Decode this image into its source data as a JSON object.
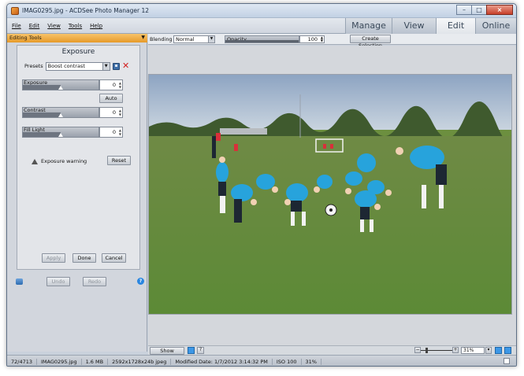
{
  "window": {
    "title": "IMAG0295.jpg - ACDSee Photo Manager 12",
    "minimize": "–",
    "maximize": "□",
    "close": "×"
  },
  "menu": {
    "items": [
      "File",
      "Edit",
      "View",
      "Tools",
      "Help"
    ]
  },
  "modes": {
    "tabs": [
      "Manage",
      "View",
      "Edit",
      "Online"
    ],
    "active": "Edit"
  },
  "editing_panel": {
    "header": "Editing Tools",
    "section_title": "Exposure",
    "presets_label": "Presets",
    "presets_value": "Boost contrast",
    "exposure_label": "Exposure",
    "exposure_value": "0",
    "auto_label": "Auto",
    "contrast_label": "Contrast",
    "contrast_value": "0",
    "fill_light_label": "Fill Light",
    "fill_light_value": "0",
    "exposure_warning_label": "Exposure warning",
    "reset_label": "Reset",
    "apply_label": "Apply",
    "done_label": "Done",
    "cancel_label": "Cancel",
    "undo_label": "Undo",
    "redo_label": "Redo",
    "help_glyph": "?"
  },
  "toolbar": {
    "blending_label": "Blending",
    "blending_value": "Normal",
    "opacity_label": "Opacity",
    "opacity_value": "100",
    "create_selection_label": "Create Selection",
    "opacity_fraction": 1.0
  },
  "bottom": {
    "show_previous_label": "Show Previous",
    "zoom_value": "31%",
    "zoom_minus": "−",
    "zoom_plus": "+"
  },
  "status": {
    "position": "72/4713",
    "filename": "IMAG0295.jpg",
    "filesize": "1.6 MB",
    "dimensions": "2592x1728x24b jpeg",
    "modified": "Modified Date: 1/7/2012 3:14:32 PM",
    "iso": "ISO 100",
    "zoom": "31%"
  },
  "colors": {
    "panel_header": "#e69a2a",
    "accent_blue": "#3d97e6",
    "delete_red": "#d21e1e"
  }
}
